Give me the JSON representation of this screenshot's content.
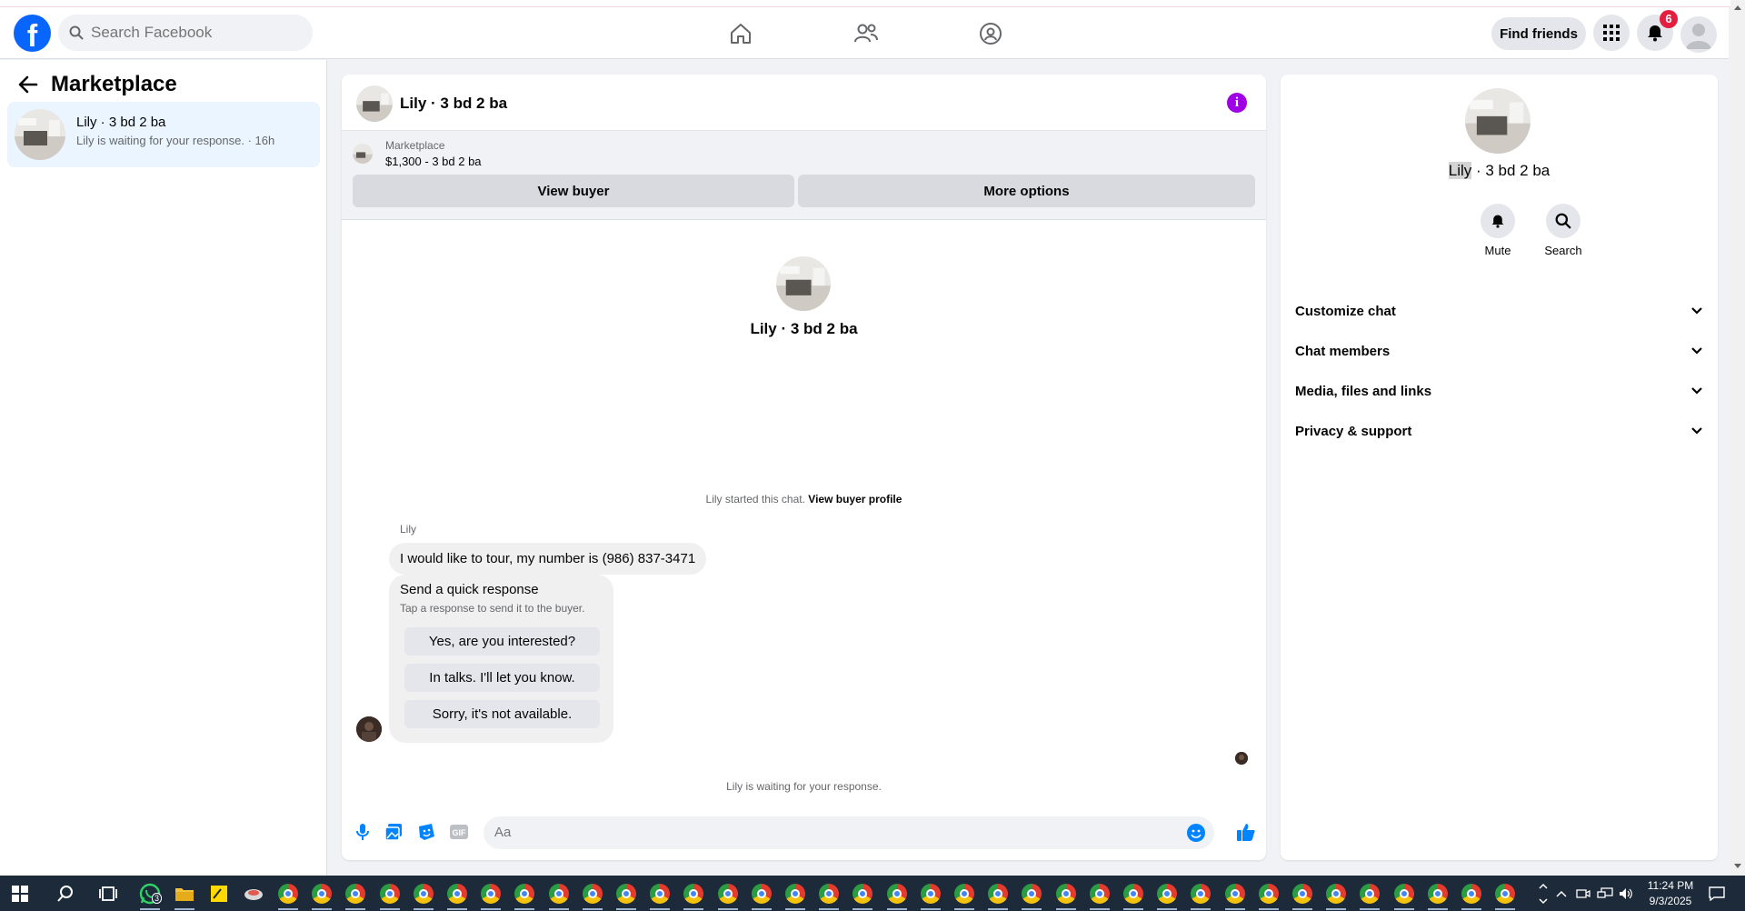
{
  "topnav": {
    "search_placeholder": "Search Facebook",
    "find_friends": "Find friends",
    "notifications_count": "6"
  },
  "left": {
    "title": "Marketplace",
    "conversation": {
      "name": "Lily · 3 bd 2 ba",
      "preview": "Lily is waiting for your response. · 16h"
    }
  },
  "chat": {
    "title": "Lily · 3 bd 2 ba",
    "marketplace_label": "Marketplace",
    "listing": "$1,300 - 3 bd 2 ba",
    "view_buyer": "View buyer",
    "more_options": "More options",
    "center_name": "Lily · 3 bd 2 ba",
    "started_text": "Lily started this chat.",
    "started_link": "View buyer profile",
    "sender": "Lily",
    "message": "I would like to tour, my number is (986) 837-3471",
    "quick_title": "Send a quick response",
    "quick_sub": "Tap a response to send it to the buyer.",
    "quick_responses": [
      "Yes, are you interested?",
      "In talks. I'll let you know.",
      "Sorry, it's not available."
    ],
    "waiting": "Lily is waiting for your response.",
    "composer_placeholder": "Aa"
  },
  "right": {
    "name_first": "Lily",
    "name_rest": " · 3 bd 2 ba",
    "mute": "Mute",
    "search": "Search",
    "sections": [
      "Customize chat",
      "Chat members",
      "Media, files and links",
      "Privacy & support"
    ]
  },
  "taskbar": {
    "whatsapp_badge": "3",
    "time": "11:24 PM",
    "date": "9/3/2025"
  },
  "colors": {
    "facebook_blue": "#0866ff",
    "messenger_blue": "#0084ff",
    "info_purple": "#a000e6",
    "badge_red": "#e41e3f"
  }
}
